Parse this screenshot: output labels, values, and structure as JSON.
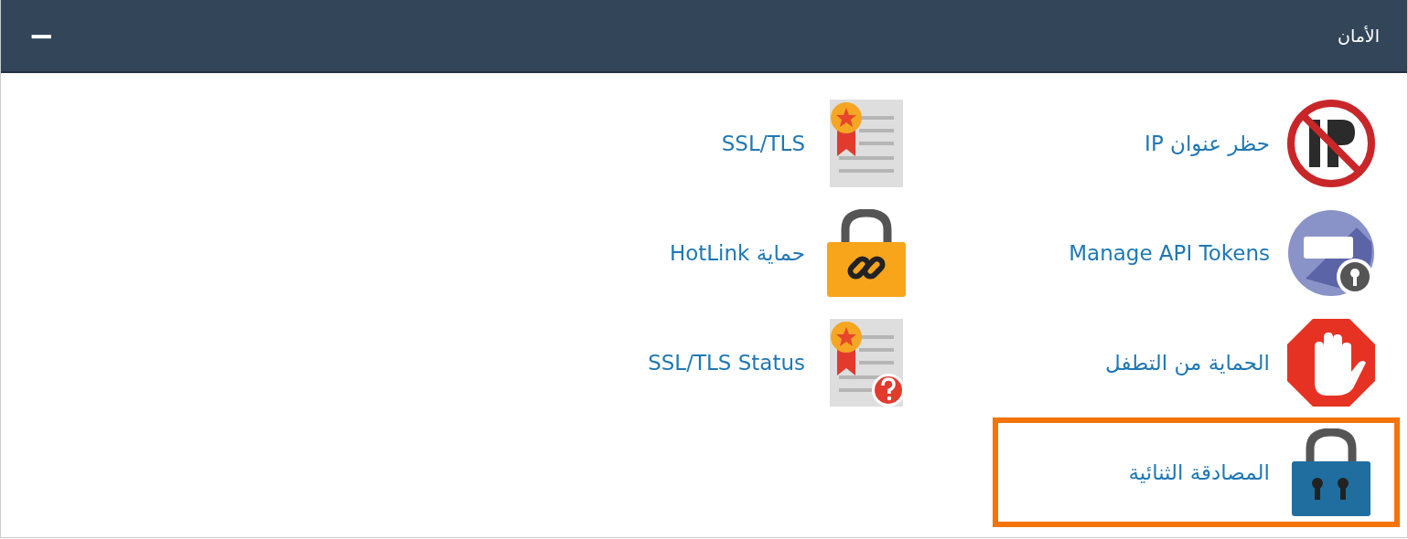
{
  "panel": {
    "title": "الأمان",
    "collapse_label": "−"
  },
  "items": [
    {
      "kind": "ip-block",
      "label": "حظر عنوان IP",
      "highlighted": false
    },
    {
      "kind": "certificate",
      "label": "SSL/TLS",
      "highlighted": false
    },
    {
      "kind": "api",
      "label": "Manage API Tokens",
      "highlighted": false
    },
    {
      "kind": "hotlink",
      "label": "حماية HotLink",
      "highlighted": false
    },
    {
      "kind": "leech",
      "label": "الحماية من التطفل",
      "highlighted": false
    },
    {
      "kind": "cert-status",
      "label": "SSL/TLS Status",
      "highlighted": false
    },
    {
      "kind": "two-factor",
      "label": "المصادقة الثنائية",
      "highlighted": true
    }
  ]
}
